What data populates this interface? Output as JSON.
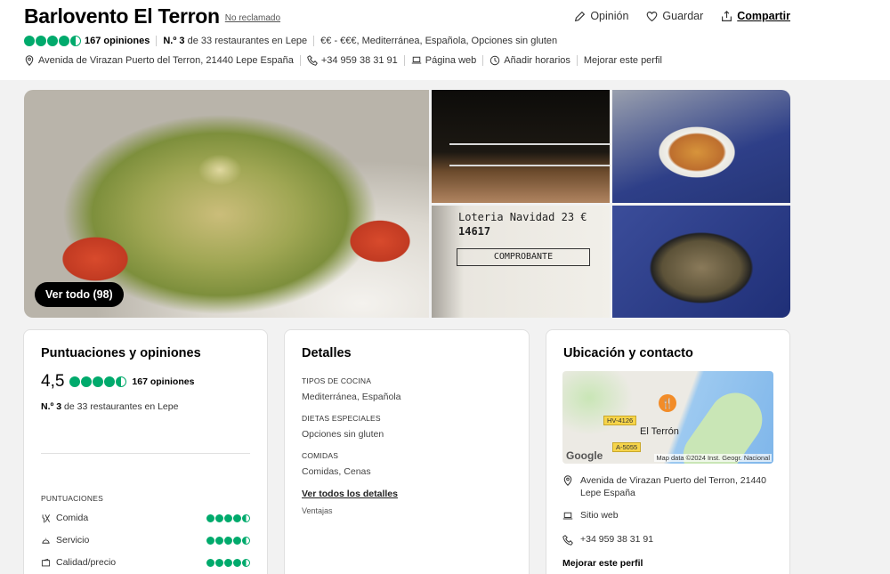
{
  "header": {
    "title": "Barlovento El Terron",
    "unclaimed": "No reclamado",
    "actions": {
      "review": "Opinión",
      "save": "Guardar",
      "share": "Compartir"
    },
    "rating_count": "167 opiniones",
    "rank_prefix": "N.º 3",
    "rank_suffix": "de 33 restaurantes en Lepe",
    "price_cuisine": "€€ - €€€, Mediterránea, Española, Opciones sin gluten",
    "address": "Avenida de Virazan Puerto del Terron, 21440 Lepe España",
    "phone": "+34 959 38 31 91",
    "website": "Página web",
    "add_hours": "Añadir horarios",
    "improve_profile": "Mejorar este perfil"
  },
  "gallery": {
    "see_all": "Ver todo (98)",
    "ticket": {
      "line1": "Loteria Navidad 23 €",
      "line2": "14617",
      "stamp": "COMPROBANTE"
    }
  },
  "ratings_card": {
    "title": "Puntuaciones y opiniones",
    "score": "4,5",
    "count": "167 opiniones",
    "rank_prefix": "N.º 3",
    "rank_suffix": "de 33 restaurantes en Lepe",
    "subheading": "PUNTUACIONES",
    "items": [
      {
        "label": "Comida",
        "rating": 4.5
      },
      {
        "label": "Servicio",
        "rating": 4.5
      },
      {
        "label": "Calidad/precio",
        "rating": 4.5
      }
    ]
  },
  "details_card": {
    "title": "Detalles",
    "cuisine_label": "TIPOS DE COCINA",
    "cuisine_value": "Mediterránea, Española",
    "diet_label": "DIETAS ESPECIALES",
    "diet_value": "Opciones sin gluten",
    "meals_label": "COMIDAS",
    "meals_value": "Comidas, Cenas",
    "see_all": "Ver todos los detalles",
    "more": "Ventajas"
  },
  "location_card": {
    "title": "Ubicación y contacto",
    "map": {
      "road1": "HV-4126",
      "road2": "A-5055",
      "place": "El Terrón",
      "google": "Google",
      "credit": "Map data ©2024 Inst. Geogr. Nacional"
    },
    "address": "Avenida de Virazan Puerto del Terron, 21440 Lepe España",
    "website": "Sitio web",
    "phone": "+34 959 38 31 91",
    "improve": "Mejorar este perfil"
  },
  "colors": {
    "bubble": "#00aa6c",
    "accent": "#000000"
  },
  "overall_rating": 4.5
}
